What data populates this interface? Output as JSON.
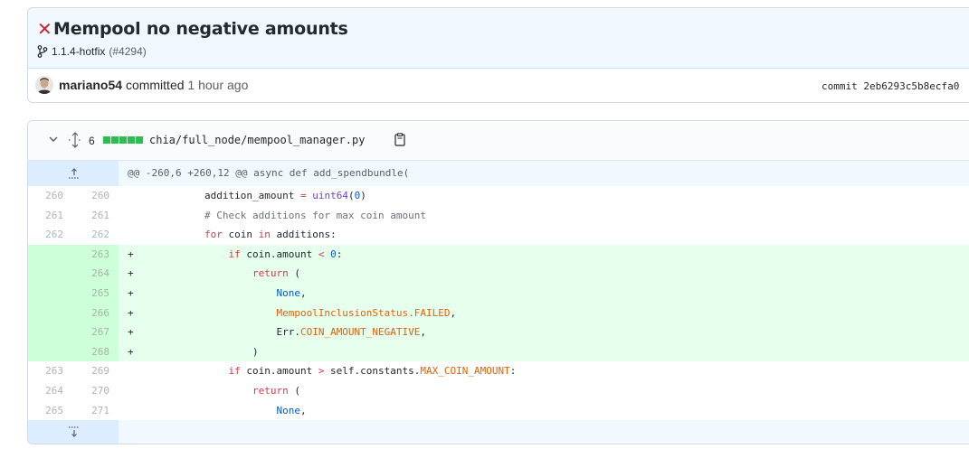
{
  "commit": {
    "title": "Mempool no negative amounts",
    "branch": "1.1.4-hotfix",
    "pr": "(#4294)",
    "author": "mariano54",
    "verb": "committed",
    "time": "1 hour ago",
    "sha_label": "commit 2eb6293c5b8ecfa0",
    "status": "failed"
  },
  "file": {
    "change_count": "6",
    "path": "chia/full_node/mempool_manager.py",
    "hunk_header": "@@ -260,6 +260,12 @@ async def add_spendbundle("
  },
  "lines": [
    {
      "old": "260",
      "new": "260",
      "sign": "",
      "type": "ctx"
    },
    {
      "old": "261",
      "new": "261",
      "sign": "",
      "type": "ctx"
    },
    {
      "old": "262",
      "new": "262",
      "sign": "",
      "type": "ctx"
    },
    {
      "old": "",
      "new": "263",
      "sign": "+",
      "type": "add"
    },
    {
      "old": "",
      "new": "264",
      "sign": "+",
      "type": "add"
    },
    {
      "old": "",
      "new": "265",
      "sign": "+",
      "type": "add"
    },
    {
      "old": "",
      "new": "266",
      "sign": "+",
      "type": "add"
    },
    {
      "old": "",
      "new": "267",
      "sign": "+",
      "type": "add"
    },
    {
      "old": "",
      "new": "268",
      "sign": "+",
      "type": "add"
    },
    {
      "old": "263",
      "new": "269",
      "sign": "",
      "type": "ctx"
    },
    {
      "old": "264",
      "new": "270",
      "sign": "",
      "type": "ctx"
    },
    {
      "old": "265",
      "new": "271",
      "sign": "",
      "type": "ctx"
    }
  ],
  "code": {
    "l0": {
      "a": "        addition_amount ",
      "op": "=",
      "b": " ",
      "fn": "uint64",
      "c": "(",
      "n": "0",
      "d": ")"
    },
    "l1": {
      "cm": "        # Check additions for max coin amount"
    },
    "l2": {
      "kw": "        for",
      "a": " coin ",
      "kw2": "in",
      "b": " additions:"
    },
    "l3": {
      "kw": "            if",
      "a": " coin.amount ",
      "op": "<",
      "b": " ",
      "n": "0",
      "c": ":"
    },
    "l4": {
      "kw": "                return",
      "a": " ("
    },
    "l5": {
      "n": "                    None",
      "a": ","
    },
    "l6": {
      "cst": "                    MempoolInclusionStatus.FAILED",
      "a": ","
    },
    "l7": {
      "a": "                    Err.",
      "cst": "COIN_AMOUNT_NEGATIVE",
      "b": ","
    },
    "l8": {
      "a": "                )"
    },
    "l9": {
      "kw": "            if",
      "a": " coin.amount ",
      "op": ">",
      "b": " self.constants.",
      "cst": "MAX_COIN_AMOUNT",
      "c": ":"
    },
    "l10": {
      "kw": "                return",
      "a": " ("
    },
    "l11": {
      "n": "                    None",
      "a": ","
    }
  },
  "colors": {
    "add_bg": "#e6ffed",
    "add_gutter": "#cdffd8",
    "hunk_bg": "#f1f8ff",
    "status_failed": "#cb2431",
    "diffstat_added": "#2cbe4e"
  },
  "icons": [
    "close-icon",
    "branch-icon",
    "chevron-down-icon",
    "expand-all-icon",
    "copy-icon",
    "expand-up-icon",
    "expand-down-icon"
  ]
}
